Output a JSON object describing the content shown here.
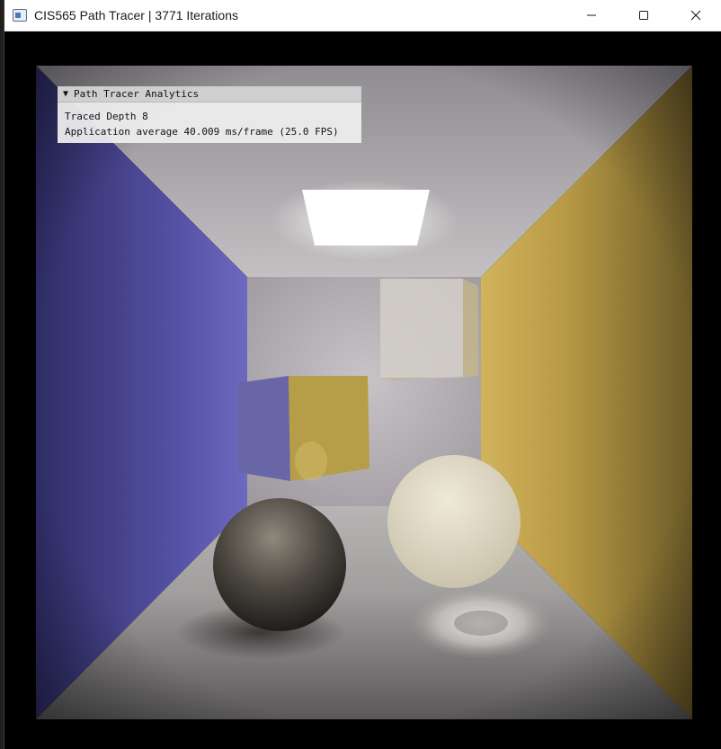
{
  "window": {
    "title": "CIS565 Path Tracer | 3771 Iterations",
    "controls": {
      "minimize_icon": "minimize-icon",
      "maximize_icon": "maximize-icon",
      "close_icon": "close-icon"
    }
  },
  "analytics": {
    "header": "Path Tracer Analytics",
    "traced_depth": "Traced Depth 8",
    "app_average": "Application average 40.009 ms/frame (25.0 FPS)"
  },
  "scene": {
    "left_wall_color": "#5a56b8",
    "right_wall_color": "#c9a84a",
    "back_wall_color": "#b4b0b6",
    "floor_color": "#a8a6a4",
    "ceiling_color": "#bebabc",
    "light_color": "#ffffff"
  }
}
